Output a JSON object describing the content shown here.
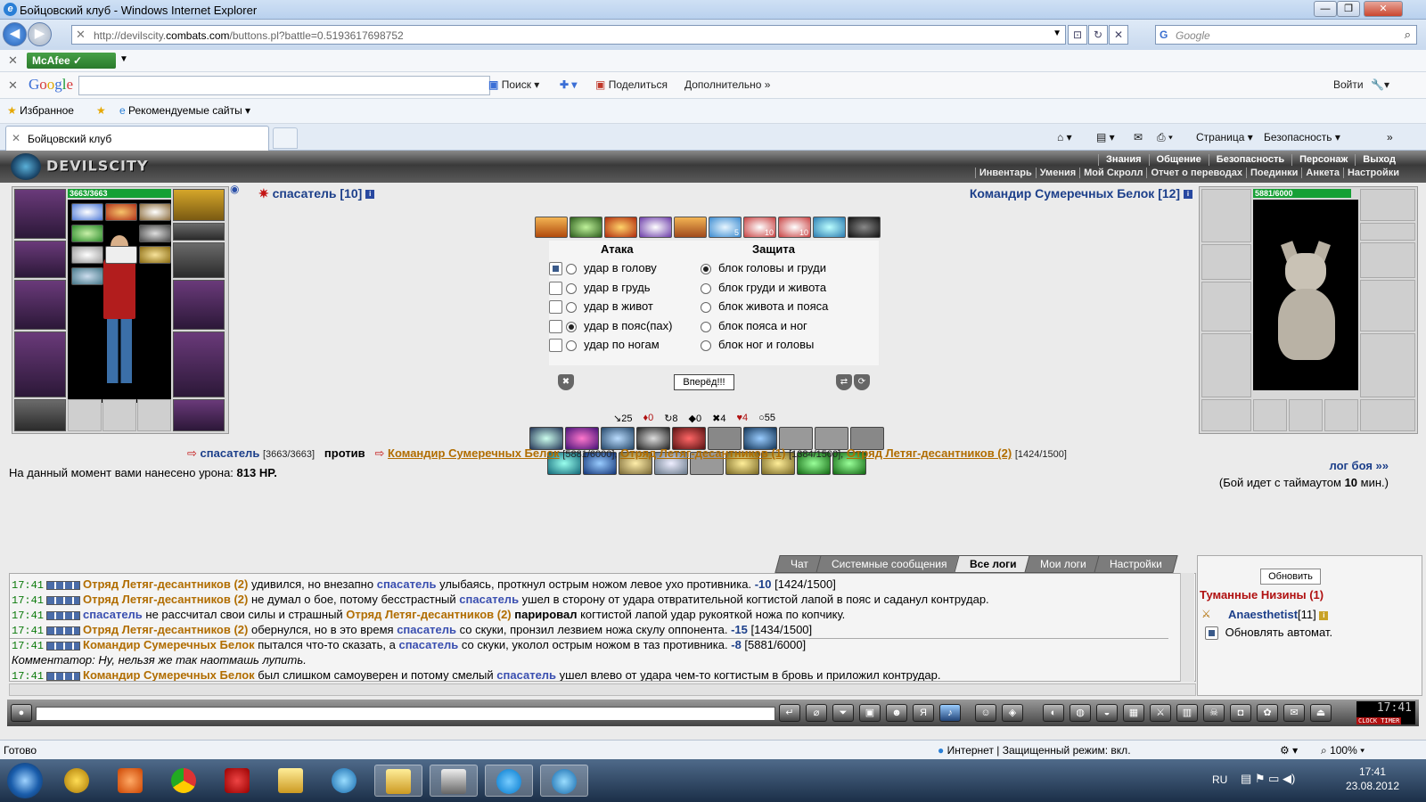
{
  "window": {
    "title": "Бойцовский клуб - Windows Internet Explorer"
  },
  "address": {
    "url_prefix": "http://devilscity.",
    "url_domain": "combats.com",
    "url_rest": "/buttons.pl?battle=0.5193617698752",
    "search_placeholder": "Google"
  },
  "mcafee": {
    "label": "McAfee"
  },
  "google_toolbar": {
    "logo": "Google",
    "search": "Поиск",
    "share": "Поделиться",
    "more": "Дополнительно »",
    "login": "Войти"
  },
  "favorites": {
    "label": "Избранное",
    "suggested": "Рекомендуемые сайты ▾"
  },
  "tab": {
    "title": "Бойцовский клуб"
  },
  "command_bar": {
    "page": "Страница ▾",
    "safety": "Безопасность ▾"
  },
  "game": {
    "logo": "DEVILSCITY",
    "menu_top": [
      "Знания",
      "Общение",
      "Безопасность",
      "Персонаж",
      "Выход"
    ],
    "menu_bottom": [
      "Инвентарь",
      "Умения",
      "Мой Скролл",
      "Отчет о переводах",
      "Поединки",
      "Анкета",
      "Настройки"
    ],
    "left_hp": "3663/3663",
    "right_hp": "5881/6000",
    "left_name": "спасатель [10]",
    "right_name": "Командир Сумеречных Белок [12]",
    "trick_counts": [
      "5",
      "10",
      "10"
    ],
    "attack_header": "Атака",
    "defense_header": "Защита",
    "attacks": [
      "удар в голову",
      "удар в грудь",
      "удар в живот",
      "удар в пояс(пах)",
      "удар по ногам"
    ],
    "defenses": [
      "блок головы и груди",
      "блок груди и живота",
      "блок живота и пояса",
      "блок пояса и ног",
      "блок ног и головы"
    ],
    "go_button": "Вперёд!!!",
    "stats": [
      "↘25",
      "♦0",
      "↻8",
      "◆0",
      "✖4",
      "♥4",
      "○55"
    ],
    "vs": {
      "me": "спасатель",
      "me_hp": "[3663/3663]",
      "versus": "против",
      "e1": "Командир Сумеречных Белок",
      "e1_hp": "[5881/6000],",
      "e2": "Отряд Летяг-десантников (1)",
      "e2_hp": "[1384/1500],",
      "e3": "Отряд Летяг-десантников (2)",
      "e3_hp": "[1424/1500]"
    },
    "damage_text": "На данный момент вами нанесено урона:",
    "damage_value": "813 HP.",
    "log_link": "лог боя »»",
    "timeout_pre": "(Бой идет с таймаутом",
    "timeout_val": "10",
    "timeout_post": "мин.)"
  },
  "chat": {
    "tabs": [
      "Чат",
      "Системные сообщения",
      "Все логи",
      "Мои логи",
      "Настройки"
    ],
    "lines": [
      {
        "time": "17:41",
        "a": "Отряд Летяг-десантников (2)",
        "t1": " удивился, но внезапно ",
        "b": "спасатель",
        "t2": " улыбаясь, проткнул острым ножом левое ухо противника. ",
        "dmg": "-10",
        "hp": " [1424/1500]"
      },
      {
        "time": "17:41",
        "a": "Отряд Летяг-десантников (2)",
        "t1": " не думал о бое, потому бесстрастный ",
        "b": "спасатель",
        "t2": " ушел в сторону от удара отвратительной когтистой лапой в пояс и саданул контрудар.",
        "dmg": "",
        "hp": ""
      },
      {
        "time": "17:41",
        "a": "спасатель",
        "t1": " не рассчитал свои силы и страшный ",
        "b": "Отряд Летяг-десантников (2)",
        "t2": " ",
        "bold": "парировал",
        "t3": " когтистой лапой удар рукояткой ножа по копчику."
      },
      {
        "time": "17:41",
        "a": "Отряд Летяг-десантников (2)",
        "t1": " обернулся, но в это время ",
        "b": "спасатель",
        "t2": " со скуки, пронзил лезвием ножа скулу оппонента. ",
        "dmg": "-15",
        "hp": " [1434/1500]"
      },
      {
        "time": "17:41",
        "a": "Командир Сумеречных Белок",
        "t1": " пытался что-то сказать, а ",
        "b": "спасатель",
        "t2": " со скуки, уколол острым ножом в таз противника. ",
        "dmg": "-8",
        "hp": " [5881/6000]"
      },
      {
        "comment": "Комментатор: Ну, нельзя же так наотмашь лупить."
      },
      {
        "time": "17:41",
        "a": "Командир Сумеречных Белок",
        "t1": " был слишком самоуверен и потому смелый ",
        "b": "спасатель",
        "t2": " ушел влево от удара чем-то когтистым в бровь и приложил контрудар.",
        "dmg": "",
        "hp": ""
      }
    ]
  },
  "online": {
    "refresh": "Обновить",
    "location": "Туманные Низины (1)",
    "user": "Anaesthetist",
    "user_level": "[11]",
    "auto": "Обновлять автомат."
  },
  "clock": {
    "time": "17:41",
    "label": "CLOCK TIMER"
  },
  "statusbar": {
    "ready": "Готово",
    "zone": "Интернет | Защищенный режим: вкл.",
    "zoom": "100% ▾"
  },
  "taskbar": {
    "lang": "RU",
    "time": "17:41",
    "date": "23.08.2012"
  },
  "colors": {
    "ally": "#1c3f8a",
    "enemy": "#b16d00",
    "hp_bar": "#16a035",
    "header": "#3a3a3a"
  }
}
